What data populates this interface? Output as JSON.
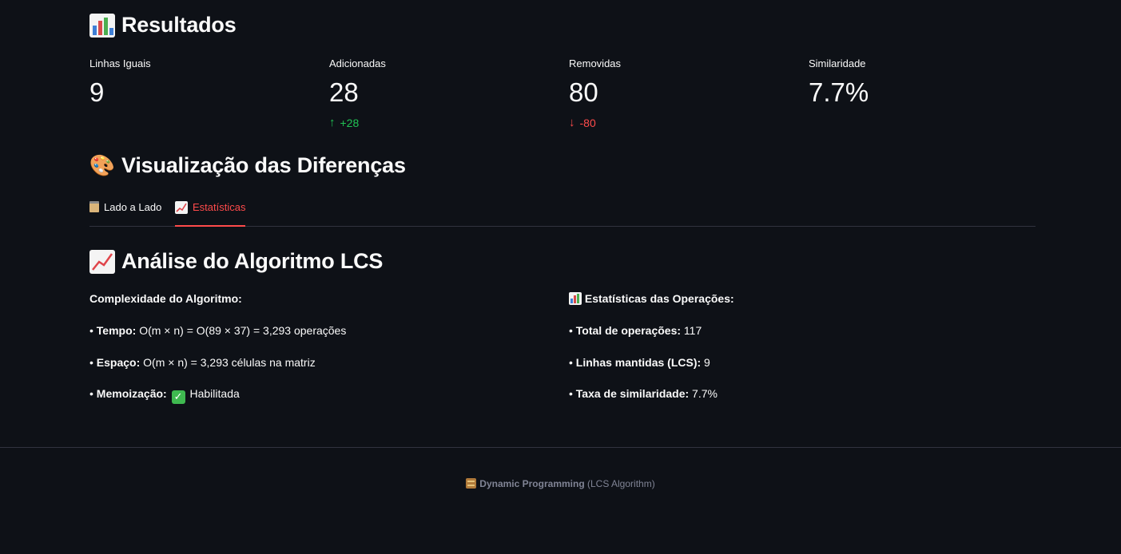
{
  "results": {
    "heading": "Resultados",
    "metrics": [
      {
        "label": "Linhas Iguais",
        "value": "9",
        "delta": ""
      },
      {
        "label": "Adicionadas",
        "value": "28",
        "delta": "+28",
        "direction": "up"
      },
      {
        "label": "Removidas",
        "value": "80",
        "delta": "-80",
        "direction": "down"
      },
      {
        "label": "Similaridade",
        "value": "7.7%",
        "delta": ""
      }
    ]
  },
  "diff": {
    "heading": "Visualização das Diferenças",
    "tabs": [
      {
        "label": "Lado a Lado",
        "icon": "clipboard-icon",
        "active": false
      },
      {
        "label": "Estatísticas",
        "icon": "chart-increasing-icon",
        "active": true
      }
    ]
  },
  "lcs": {
    "heading": "Análise do Algoritmo LCS",
    "complexity": {
      "title": "Complexidade do Algoritmo:",
      "time_label": "Tempo:",
      "time_value": "O(m × n) = O(89 × 37) = 3,293 operações",
      "space_label": "Espaço:",
      "space_value": "O(m × n) = 3,293 células na matriz",
      "memo_label": "Memoização:",
      "memo_value": "Habilitada"
    },
    "stats": {
      "title": "Estatísticas das Operações:",
      "total_label": "Total de operações:",
      "total_value": "117",
      "kept_label": "Linhas mantidas (LCS):",
      "kept_value": "9",
      "rate_label": "Taxa de similaridade:",
      "rate_value": "7.7%"
    }
  },
  "footer": {
    "bold": "Dynamic Programming",
    "rest": "(LCS Algorithm)"
  },
  "colors": {
    "background": "#0e1117",
    "accent": "#ff4b4b",
    "positive": "#21c354",
    "negative": "#ff4b4b"
  }
}
